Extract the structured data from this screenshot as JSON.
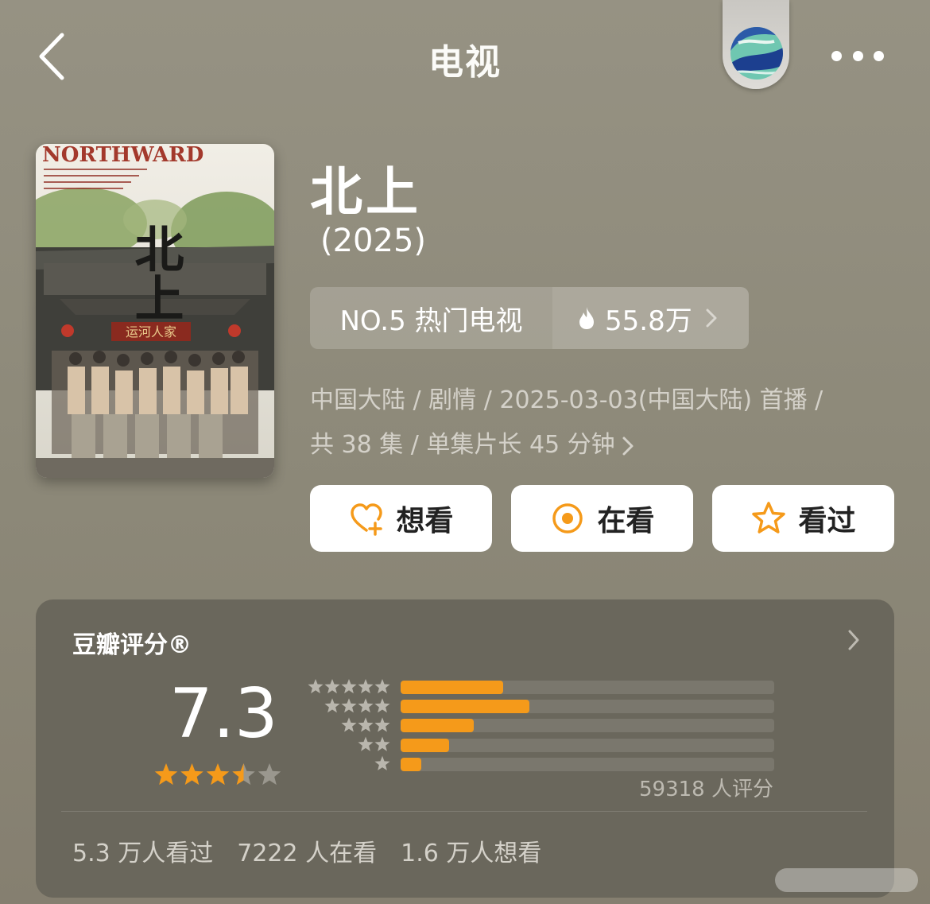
{
  "header": {
    "title": "电视",
    "back_icon": "chevron-left-icon",
    "more_icon": "more-dots-icon",
    "avatar_icon": "wave-avatar"
  },
  "poster": {
    "title_en": "NORTHWARD",
    "calligraphy": "北上",
    "shop_sign": "运河人家"
  },
  "show": {
    "title": "北上",
    "year": "(2025)"
  },
  "rank": {
    "label": "NO.5 热门电视",
    "heat": "55.8万"
  },
  "meta": {
    "line1": "中国大陆 / 剧情 / 2025-03-03(中国大陆) 首播 /",
    "line2": "共 38 集 / 单集片长 45 分钟"
  },
  "actions": {
    "want": "想看",
    "watching": "在看",
    "watched": "看过"
  },
  "rating": {
    "label": "豆瓣评分®",
    "score": "7.3",
    "stars_value": 3.5,
    "stars_max": 5,
    "distribution": [
      {
        "stars": 5,
        "fraction": 0.275
      },
      {
        "stars": 4,
        "fraction": 0.345
      },
      {
        "stars": 3,
        "fraction": 0.195
      },
      {
        "stars": 2,
        "fraction": 0.13
      },
      {
        "stars": 1,
        "fraction": 0.055
      }
    ],
    "count_text": "59318 人评分",
    "accent": "#f59a1a"
  },
  "stats": {
    "watched": "5.3 万人看过",
    "watching": "7222 人在看",
    "want": "1.6 万人想看"
  }
}
